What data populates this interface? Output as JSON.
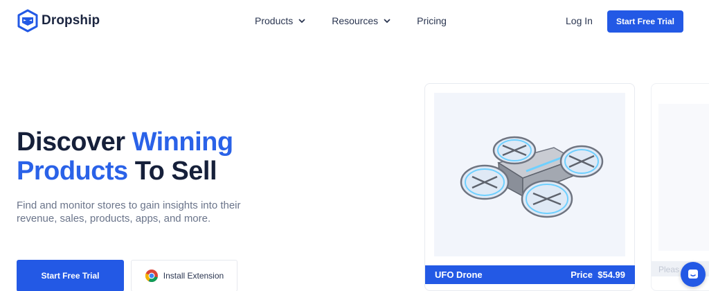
{
  "brand": {
    "name": "Dropship",
    "logo_icon": "ninja-box-icon",
    "color": "#2359e5"
  },
  "nav": {
    "items": [
      {
        "label": "Products",
        "has_dropdown": true
      },
      {
        "label": "Resources",
        "has_dropdown": true
      },
      {
        "label": "Pricing",
        "has_dropdown": false
      }
    ],
    "login_label": "Log In",
    "cta_label": "Start Free Trial"
  },
  "hero": {
    "title_part1": "Discover ",
    "title_highlight1": "Winning",
    "title_highlight2": "Products",
    "title_part2": " To Sell",
    "subtitle": "Find and monitor stores to gain insights into their revenue, sales, products, apps, and more.",
    "primary_button": "Start Free Trial",
    "secondary_button": "Install Extension",
    "secondary_icon": "chrome-icon"
  },
  "product_card": {
    "name": "UFO Drone",
    "price_label": "Price",
    "price": "$54.99",
    "image_icon": "drone-icon"
  },
  "next_card": {
    "partial_label": "Pleas"
  },
  "chat": {
    "icon": "chat-icon"
  }
}
